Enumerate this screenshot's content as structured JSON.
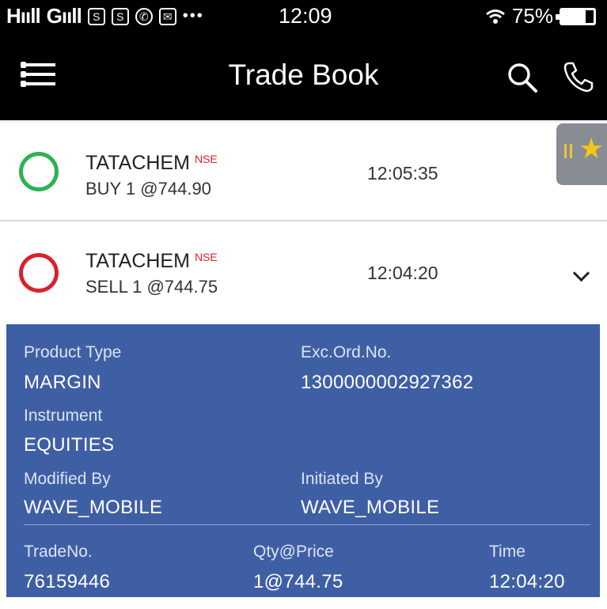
{
  "status_bar": {
    "carrier1": "Hııll",
    "carrier2": "Gııll",
    "time": "12:09",
    "battery": "75%",
    "battery_level": 0.75,
    "icons": [
      "sim-s-icon",
      "sim-s-icon",
      "whatsapp-icon",
      "mail-icon",
      "more-icon",
      "wifi-icon",
      "battery-icon"
    ]
  },
  "app_bar": {
    "title": "Trade Book",
    "icons": [
      "menu-icon",
      "search-icon",
      "phone-icon"
    ]
  },
  "trades": [
    {
      "symbol": "TATACHEM",
      "exchange": "NSE",
      "detail": "BUY 1  @744.90",
      "time": "12:05:35",
      "side_color": "#2bb352"
    },
    {
      "symbol": "TATACHEM",
      "exchange": "NSE",
      "detail": "SELL 1  @744.75",
      "time": "12:04:20",
      "side_color": "#d8232a"
    }
  ],
  "details": {
    "product_type_label": "Product Type",
    "product_type": "MARGIN",
    "exc_ord_no_label": "Exc.Ord.No.",
    "exc_ord_no": "1300000002927362",
    "instrument_label": "Instrument",
    "instrument": "EQUITIES",
    "modified_by_label": "Modified By",
    "modified_by": "WAVE_MOBILE",
    "initiated_by_label": "Initiated By",
    "initiated_by": "WAVE_MOBILE",
    "trade_no_label": "TradeNo.",
    "trade_no": "76159446",
    "qty_price_label": "Qty@Price",
    "qty_price": "1@744.75",
    "time_label": "Time",
    "time": "12:04:20"
  },
  "colors": {
    "panel_bg": "#3f5fa5",
    "app_bar_bg": "#000000",
    "exchange_text": "#e0202a"
  }
}
